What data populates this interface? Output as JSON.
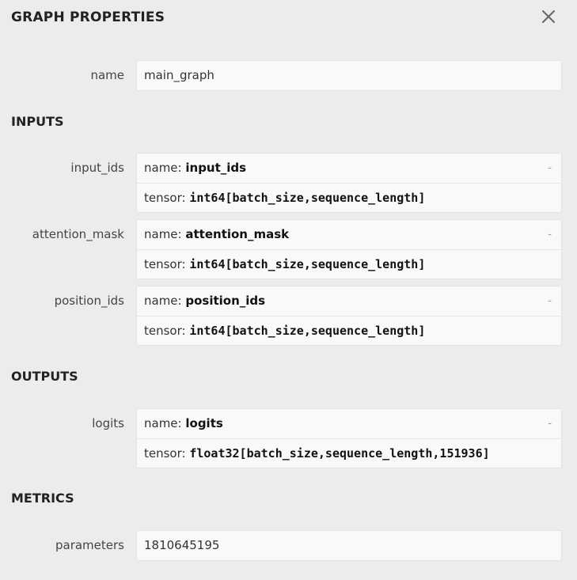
{
  "header": {
    "title": "GRAPH PROPERTIES"
  },
  "graph": {
    "name_label": "name",
    "name_value": "main_graph"
  },
  "inputs": {
    "section_title": "INPUTS",
    "items": [
      {
        "label": "input_ids",
        "name_prefix": "name: ",
        "name": "input_ids",
        "tensor_prefix": "tensor: ",
        "tensor": "int64[batch_size,sequence_length]",
        "expander": "-"
      },
      {
        "label": "attention_mask",
        "name_prefix": "name: ",
        "name": "attention_mask",
        "tensor_prefix": "tensor: ",
        "tensor": "int64[batch_size,sequence_length]",
        "expander": "-"
      },
      {
        "label": "position_ids",
        "name_prefix": "name: ",
        "name": "position_ids",
        "tensor_prefix": "tensor: ",
        "tensor": "int64[batch_size,sequence_length]",
        "expander": "-"
      }
    ]
  },
  "outputs": {
    "section_title": "OUTPUTS",
    "items": [
      {
        "label": "logits",
        "name_prefix": "name: ",
        "name": "logits",
        "tensor_prefix": "tensor: ",
        "tensor": "float32[batch_size,sequence_length,151936]",
        "expander": "-"
      }
    ]
  },
  "metrics": {
    "section_title": "METRICS",
    "parameters_label": "parameters",
    "parameters_value": "1810645195"
  }
}
